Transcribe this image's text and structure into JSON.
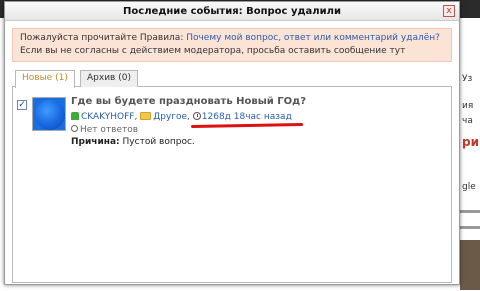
{
  "background": {
    "fragments": [
      "Уз",
      "ия",
      "ча",
      "ри",
      "gle"
    ]
  },
  "dialog": {
    "title": "Последние события: Вопрос удалили",
    "close_label": "x"
  },
  "notice": {
    "prefix": "Пожалуйста прочитайте Правила: ",
    "link": "Почему мой вопрос, ответ или комментарий удалён?",
    "line2": "Если вы не согласны с действием модератора, просьба оставить сообщение тут"
  },
  "tabs": [
    {
      "label": "Новые (1)",
      "active": true
    },
    {
      "label": "Архив (0)",
      "active": false
    }
  ],
  "item": {
    "checked": true,
    "title": "Где вы будете праздновать Новый ГОд?",
    "user": "CKAKYHOFF",
    "category": "Другое",
    "time": "1268д 18час назад",
    "answers": "Нет ответов",
    "reason_label": "Причина:",
    "reason_text": "Пустой вопрос."
  },
  "colors": {
    "accent_link": "#2a5db0",
    "notice_bg": "#fbe3d6",
    "annotation": "#d11111"
  }
}
